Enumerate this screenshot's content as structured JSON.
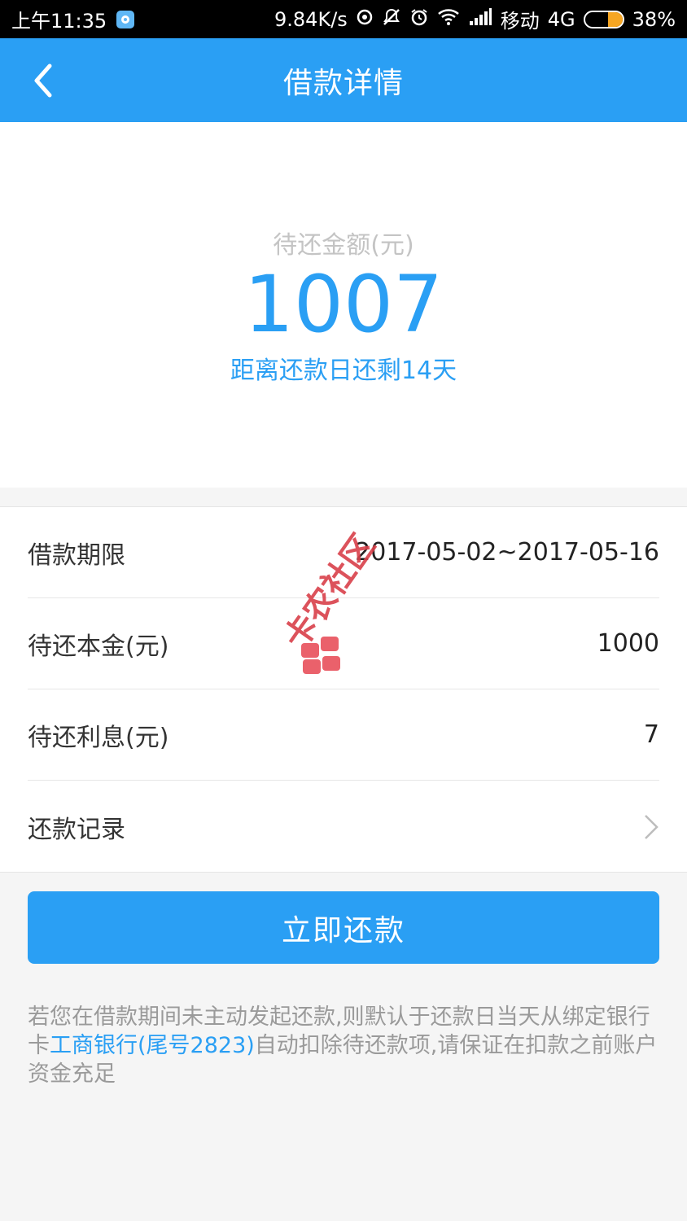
{
  "status_bar": {
    "time": "上午11:35",
    "speed": "9.84K/s",
    "carrier": "移动",
    "network": "4G",
    "battery_percent": "38%",
    "battery_level": 0.38,
    "icons": [
      "app-icon",
      "data-sync-icon",
      "mute-icon",
      "alarm-icon",
      "wifi-icon",
      "signal-icon",
      "battery-icon"
    ]
  },
  "header": {
    "title": "借款详情",
    "back_icon": "chevron-left-icon"
  },
  "summary": {
    "label": "待还金额(元)",
    "amount": "1007",
    "countdown": "距离还款日还剩14天"
  },
  "details": {
    "rows": [
      {
        "label": "借款期限",
        "value": "2017-05-02~2017-05-16"
      },
      {
        "label": "待还本金(元)",
        "value": "1000"
      },
      {
        "label": "待还利息(元)",
        "value": "7"
      },
      {
        "label": "还款记录",
        "value": ""
      }
    ]
  },
  "watermark_text": "卡农社区",
  "actions": {
    "repay_label": "立即还款"
  },
  "notice": {
    "part1": "若您在借款期间未主动发起还款,则默认于还款日当天从绑定银行卡",
    "bank": "工商银行(尾号2823)",
    "part2": "自动扣除待还款项,请保证在扣款之前账户资金充足"
  },
  "colors": {
    "primary": "#2a9ff4",
    "status_bar_bg": "#000000",
    "page_bg": "#f5f5f5",
    "battery": "#f6a623"
  }
}
